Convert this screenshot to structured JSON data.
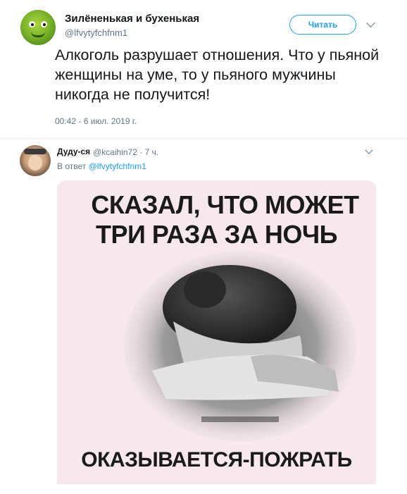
{
  "main_tweet": {
    "author_name": "Зилёненькая и бухенькая",
    "author_handle": "@lfvytyfchfnm1",
    "follow_label": "Читать",
    "text": "Алкоголь разрушает отношения. Что у пьяной женщины на уме, то у пьяного мужчины никогда не получится!",
    "timestamp": "00:42 - 6 июл. 2019 г."
  },
  "reply": {
    "author_name": "Дуду-ся",
    "meta": "@kcaihin72 · 7 ч.",
    "in_reply_prefix": "В ответ",
    "in_reply_handle": "@lfvytyfchfnm1",
    "meme_top_line1": "СКАЗАЛ, ЧТО МОЖЕТ",
    "meme_top_line2": "ТРИ РАЗА ЗА НОЧЬ",
    "meme_bottom": "ОКАЗЫВАЕТСЯ-ПОЖРАТЬ"
  },
  "icons": {
    "menu_caret": "chevron-down-icon"
  },
  "colors": {
    "accent": "#1da1f2",
    "secondary_text": "#657786",
    "divider": "#e6ecf0",
    "meme_background": "#f7e8ee"
  }
}
